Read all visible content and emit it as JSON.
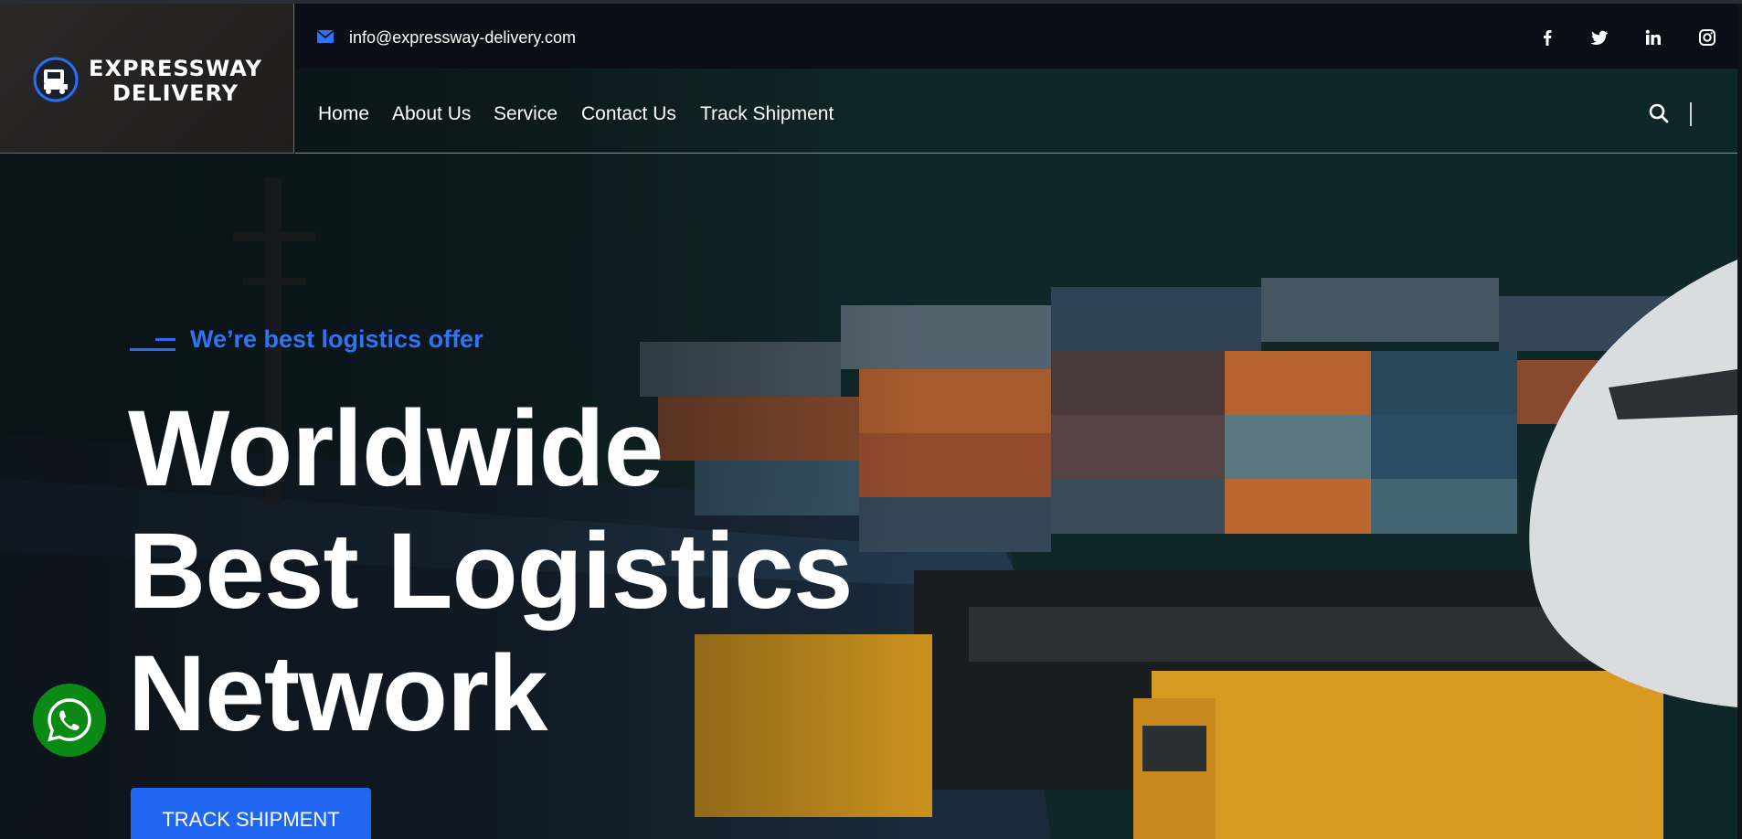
{
  "brand": {
    "name_line1": "EXPRESSWAY",
    "name_line2": "DELIVERY"
  },
  "topbar": {
    "email": "info@expressway-delivery.com",
    "socials": [
      "facebook-icon",
      "twitter-icon",
      "linkedin-icon",
      "instagram-icon"
    ]
  },
  "nav": {
    "items": [
      {
        "label": "Home"
      },
      {
        "label": "About Us"
      },
      {
        "label": "Service"
      },
      {
        "label": "Contact Us"
      },
      {
        "label": "Track Shipment"
      }
    ]
  },
  "hero": {
    "tagline": "We’re best logistics offer",
    "headline_line1": "Worldwide",
    "headline_line2": "Best Logistics",
    "headline_line3": "Network",
    "cta_label": "TRACK SHIPMENT"
  },
  "colors": {
    "accent": "#2166f3",
    "topbar_bg": "#0a0f17",
    "whatsapp": "#0a8a14"
  }
}
